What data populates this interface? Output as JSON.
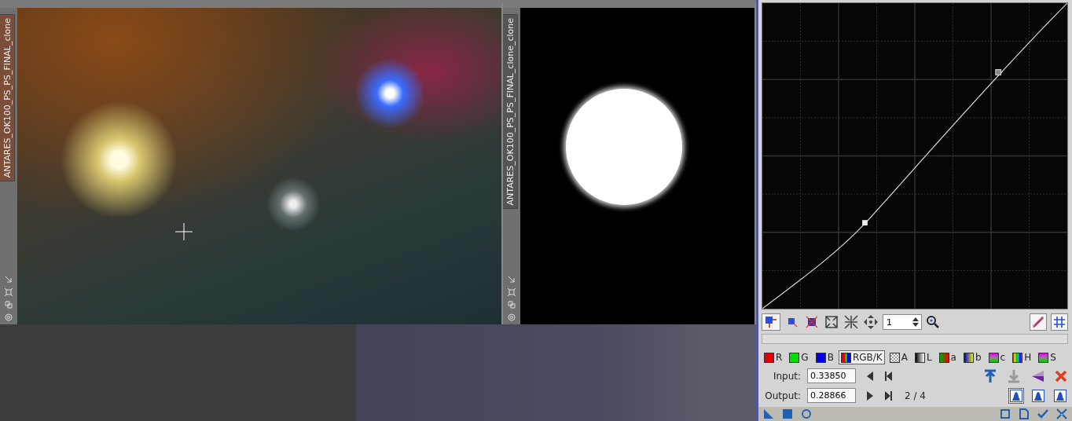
{
  "image_windows": [
    {
      "tab_label": "ANTARES_OK100_PS_PS_FINAL_clone",
      "kind": "photo",
      "tab_active": true
    },
    {
      "tab_label": "ANTARES_OK100_PS_PS_FINAL_clone_clone",
      "kind": "mask",
      "tab_active": false
    }
  ],
  "curves": {
    "zoom": "1",
    "channels": [
      {
        "label": "R",
        "kind": "solid",
        "color": "#e00000",
        "selected": false
      },
      {
        "label": "G",
        "kind": "solid",
        "color": "#00e000",
        "selected": false
      },
      {
        "label": "B",
        "kind": "solid",
        "color": "#0000e8",
        "selected": false
      },
      {
        "label": "RGB/K",
        "kind": "rgb",
        "selected": true
      },
      {
        "label": "A",
        "kind": "alpha",
        "selected": false
      },
      {
        "label": "L",
        "kind": "lightness",
        "selected": false
      },
      {
        "label": "a",
        "kind": "a",
        "selected": false
      },
      {
        "label": "b",
        "kind": "b",
        "selected": false
      },
      {
        "label": "c",
        "kind": "c",
        "selected": false
      },
      {
        "label": "H",
        "kind": "hue",
        "selected": false
      },
      {
        "label": "S",
        "kind": "sat",
        "selected": false
      }
    ],
    "input_label": "Input:",
    "input": "0.33850",
    "output_label": "Output:",
    "output": "0.28866",
    "point_counter": "2 / 4",
    "interpolation_modes": [
      {
        "selected": true
      },
      {
        "selected": false
      },
      {
        "selected": false
      }
    ]
  }
}
